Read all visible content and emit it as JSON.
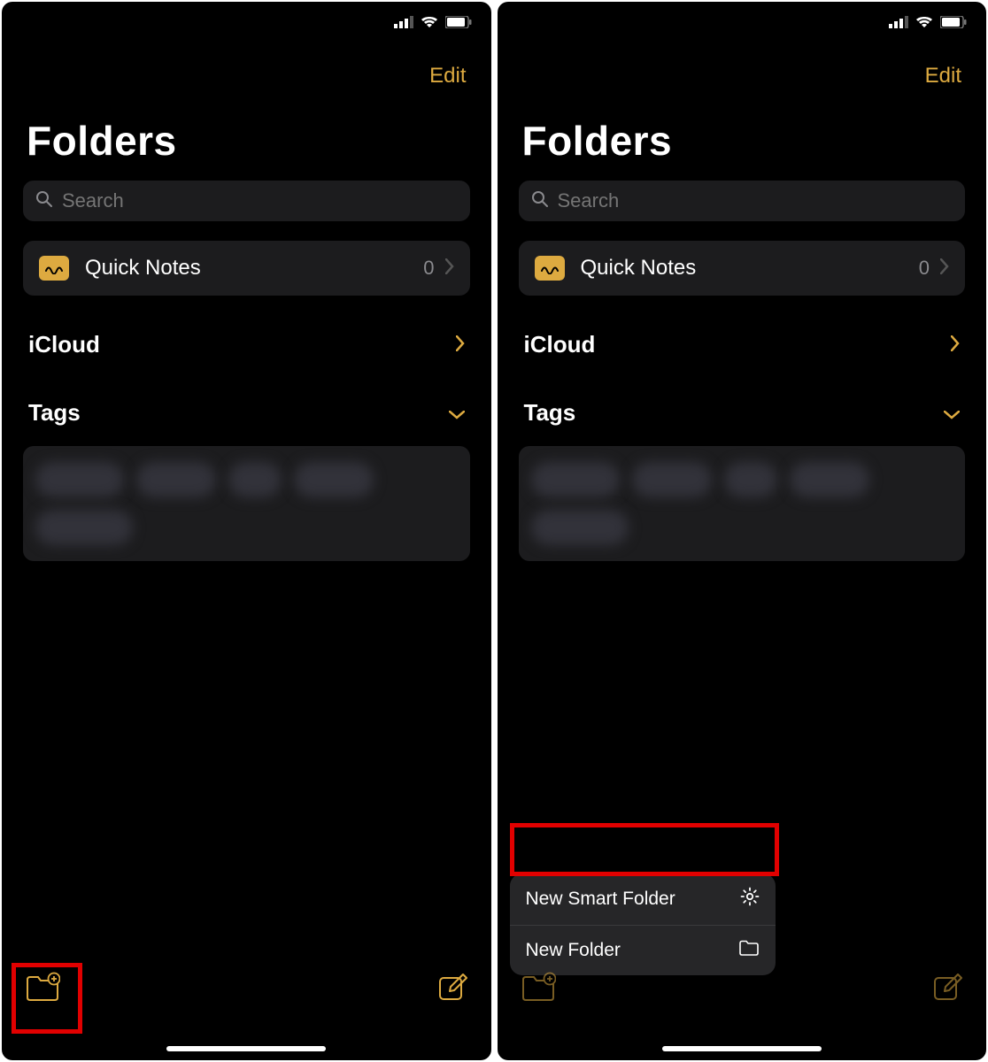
{
  "accent": "#ddaa40",
  "header": {
    "edit": "Edit"
  },
  "title": "Folders",
  "search": {
    "placeholder": "Search"
  },
  "quick_notes": {
    "label": "Quick Notes",
    "count": "0"
  },
  "sections": {
    "icloud": {
      "label": "iCloud"
    },
    "tags": {
      "label": "Tags"
    }
  },
  "tags_placeholder_count": 5,
  "menu": {
    "new_smart_folder": "New Smart Folder",
    "new_folder": "New Folder"
  },
  "icons": {
    "search": "search-icon",
    "new_folder": "new-folder-icon",
    "compose": "compose-icon",
    "chevron_right": "chevron-right-icon",
    "chevron_down": "chevron-down-icon",
    "signal": "cellular-icon",
    "wifi": "wifi-icon",
    "battery": "battery-icon",
    "gear": "gear-icon",
    "folder": "folder-icon"
  }
}
